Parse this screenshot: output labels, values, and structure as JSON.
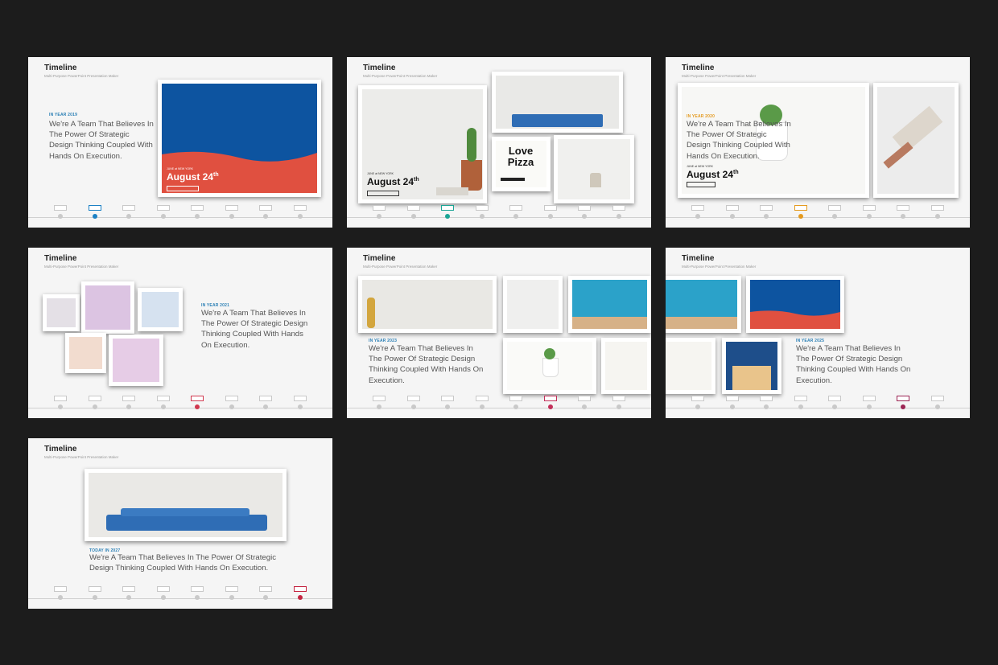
{
  "common": {
    "title": "Timeline",
    "subtitle": "Multi-Purpose PowerPoint Presentation Maker",
    "statement": "We're A Team That Believes In The Power Of Strategic Design Thinking Coupled With Hands On Execution."
  },
  "slides": [
    {
      "eyebrow": "IN YEAR 2019",
      "accent": "#1b80c4",
      "active_index": 1,
      "card_title": "August 24",
      "card_sup": "th",
      "card_small": "JUNE at NEW YORK"
    },
    {
      "card_title": "August 24",
      "card_sup": "th",
      "card_small": "JUNE at NEW YORK",
      "poster": "Love Pizza",
      "accent": "#1aa595",
      "active_index": 2
    },
    {
      "eyebrow": "IN YEAR 2020",
      "accent": "#e49a1f",
      "active_index": 3,
      "card_title": "August 24",
      "card_sup": "th",
      "card_small": "JUNE at NEW YORK"
    },
    {
      "eyebrow": "IN YEAR 2021",
      "accent": "#d1384f",
      "active_index": 4
    },
    {
      "eyebrow": "IN YEAR 2023",
      "accent": "#c2305a",
      "active_index": 5
    },
    {
      "eyebrow": "IN YEAR 2025",
      "accent": "#9c2554",
      "active_index": 6
    },
    {
      "eyebrow": "TODAY IN 2027",
      "accent": "#c42440",
      "active_index": 7
    }
  ],
  "colors": {
    "eyebrow_blue": "#2a7fb5",
    "card_blue": "#0d54a0",
    "card_red": "#e05040",
    "sofa_blue": "#2f6db5"
  }
}
